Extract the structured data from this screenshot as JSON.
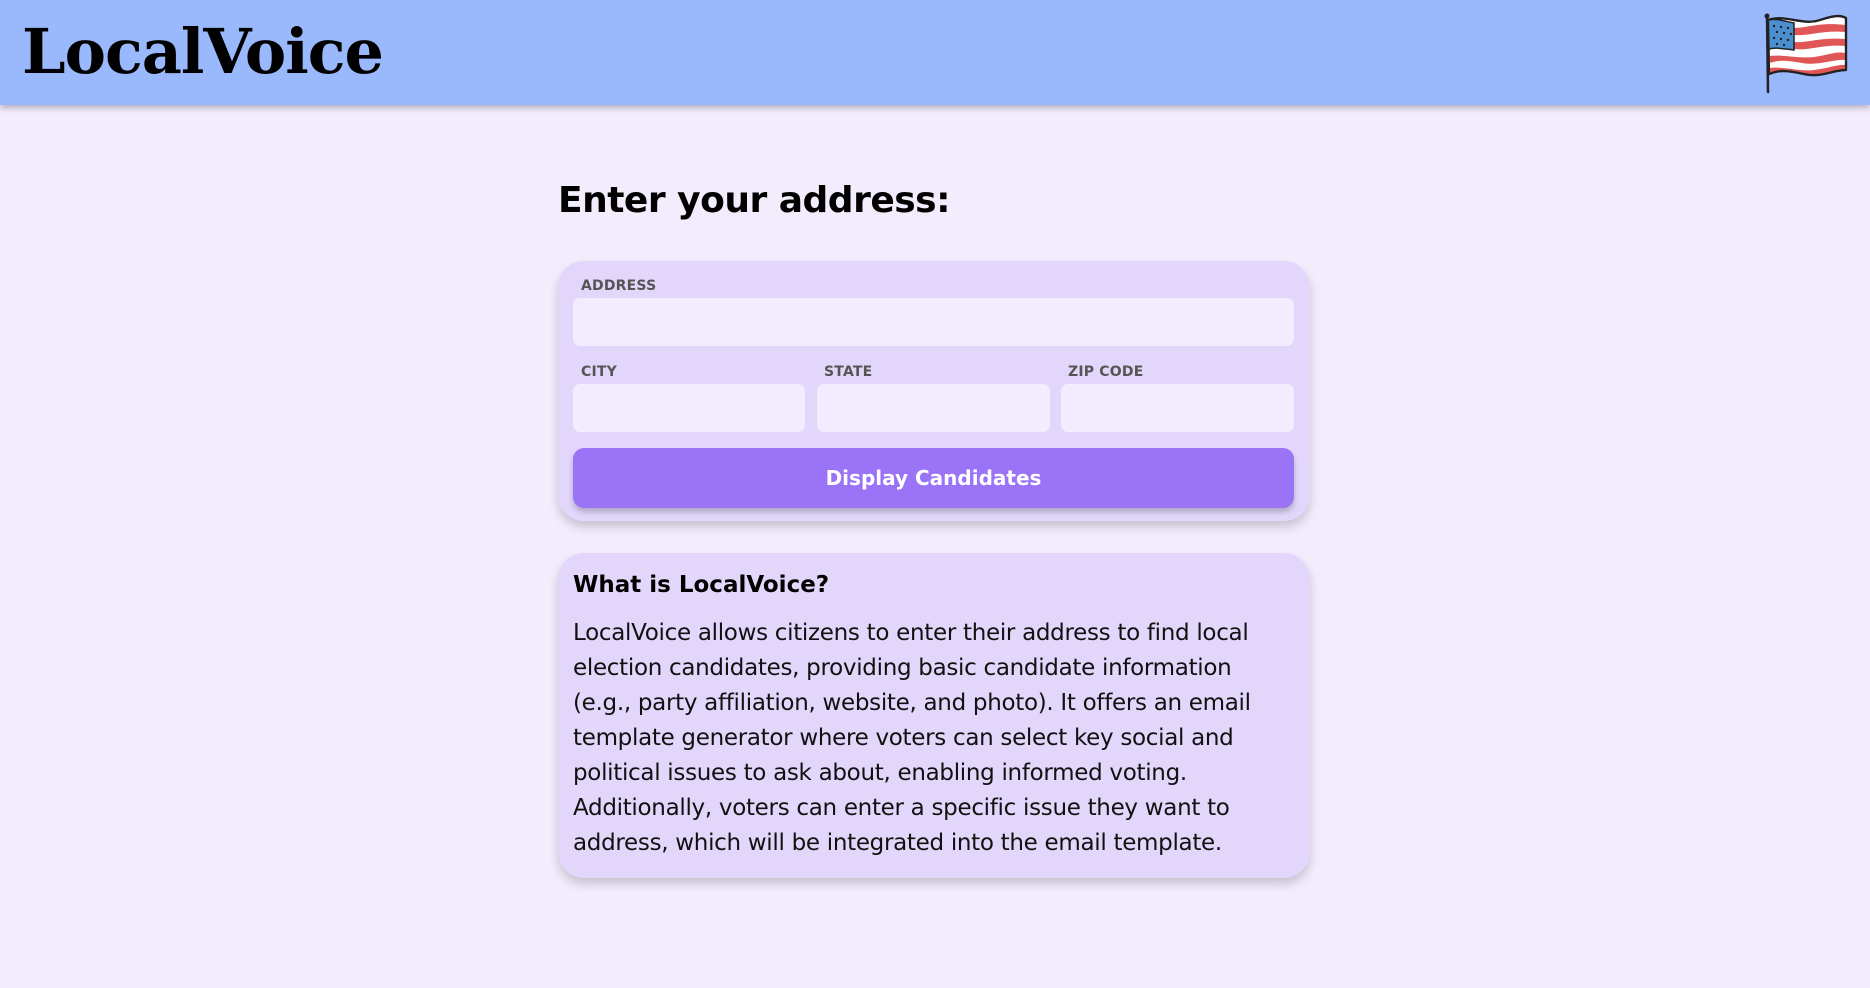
{
  "header": {
    "logo": "LocalVoice",
    "flag_icon": "us-flag-icon"
  },
  "main": {
    "title": "Enter your address:"
  },
  "form": {
    "address_label": "ADDRESS",
    "address_value": "",
    "city_label": "CITY",
    "city_value": "",
    "state_label": "STATE",
    "state_value": "",
    "zip_label": "ZIP CODE",
    "zip_value": "",
    "submit_label": "Display Candidates"
  },
  "info": {
    "title": "What is LocalVoice?",
    "body": "LocalVoice allows citizens to enter their address to find local election candidates, providing basic candidate information (e.g., party affiliation, website, and photo). It offers an email template generator where voters can select key social and political issues to ask about, enabling informed voting. Additionally, voters can enter a specific issue they want to address, which will be integrated into the email template."
  },
  "colors": {
    "header_bg": "#99b9fc",
    "page_bg": "#f3ecfd",
    "card_bg": "#e2d7fb",
    "input_bg": "#f1ecfe",
    "button_bg": "#9b73f7"
  }
}
